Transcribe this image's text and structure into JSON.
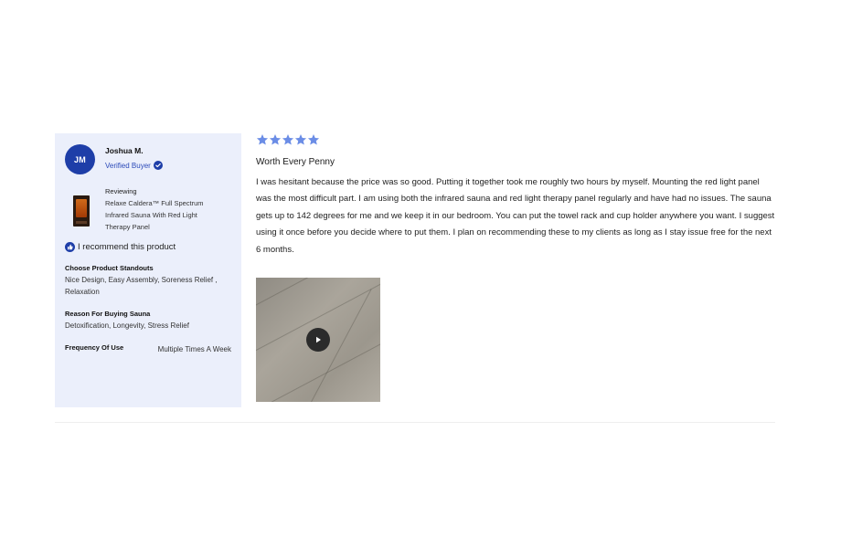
{
  "review": {
    "author": {
      "initials": "JM",
      "name": "Joshua M.",
      "verified_label": "Verified Buyer",
      "verified_icon": "check-badge-icon"
    },
    "reviewing": {
      "label": "Reviewing",
      "product_name": "Relaxe Caldera™ Full Spectrum Infrared Sauna With Red Light Therapy Panel"
    },
    "recommend": {
      "icon": "thumbs-up-icon",
      "text": "I recommend this product"
    },
    "fields": {
      "standouts": {
        "label": "Choose Product Standouts",
        "value": "Nice Design, Easy Assembly, Soreness Relief , Relaxation"
      },
      "reason": {
        "label": "Reason For Buying Sauna",
        "value": "Detoxification, Longevity, Stress Relief"
      },
      "frequency": {
        "label": "Frequency Of Use",
        "value": "Multiple Times A Week"
      }
    },
    "rating": 5,
    "title": "Worth Every Penny",
    "body": "I was hesitant because the price was so good. Putting it together took me roughly two hours by myself. Mounting the red light panel was the most difficult part. I am using both the infrared sauna and red light therapy panel regularly and have had no issues. The sauna gets up to 142 degrees for me and we keep it in our bedroom. You can put the towel rack and cup holder anywhere you want. I suggest using it once before you decide where to put them. I plan on recommending these to my clients as long as I stay issue free for the next 6 months.",
    "media": {
      "type": "video",
      "play_icon": "play-icon"
    }
  },
  "colors": {
    "accent": "#1e3ea8",
    "star": "#6b8de6",
    "sidebar_bg": "#ebeffb"
  }
}
